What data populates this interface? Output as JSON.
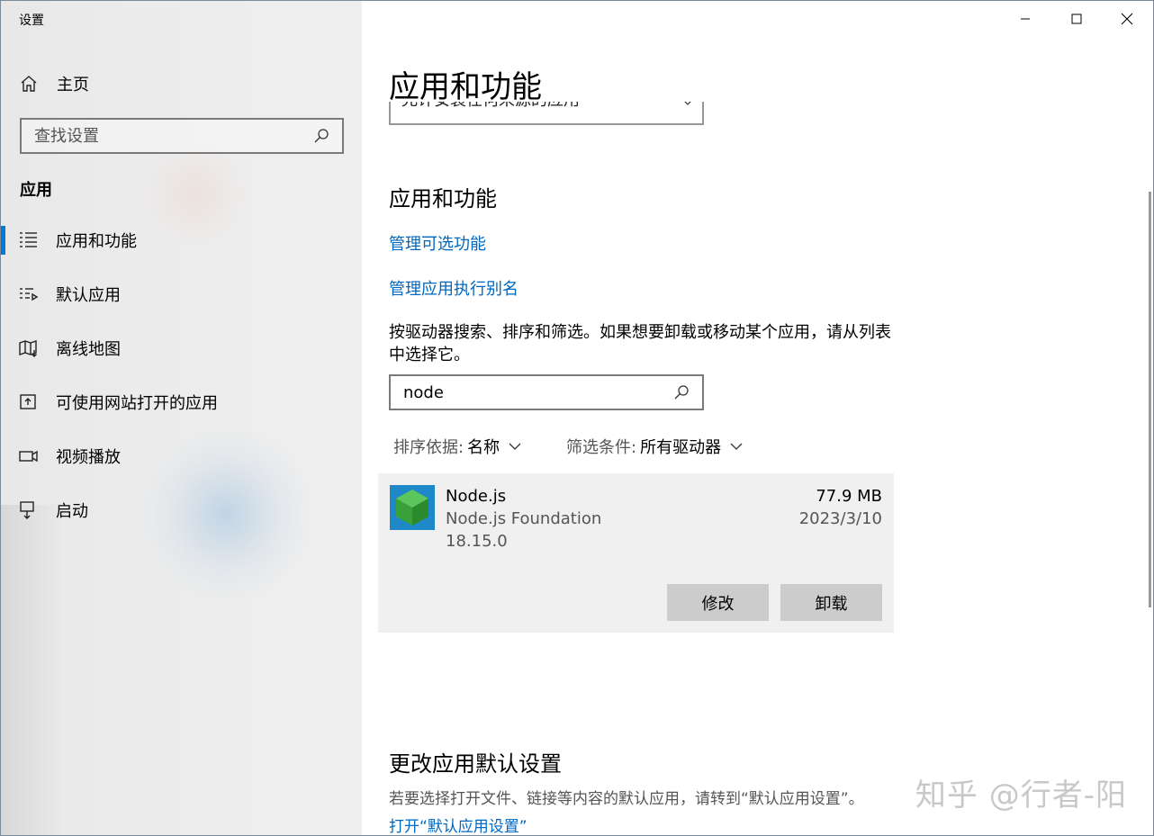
{
  "window": {
    "title": "设置"
  },
  "sidebar": {
    "home_label": "主页",
    "search_placeholder": "查找设置",
    "section_label": "应用",
    "items": [
      {
        "label": "应用和功能",
        "icon": "apps-features-icon",
        "active": true
      },
      {
        "label": "默认应用",
        "icon": "default-apps-icon",
        "active": false
      },
      {
        "label": "离线地图",
        "icon": "offline-maps-icon",
        "active": false
      },
      {
        "label": "可使用网站打开的应用",
        "icon": "apps-for-websites-icon",
        "active": false
      },
      {
        "label": "视频播放",
        "icon": "video-playback-icon",
        "active": false
      },
      {
        "label": "启动",
        "icon": "startup-icon",
        "active": false
      }
    ]
  },
  "main": {
    "page_title": "应用和功能",
    "partial_dropdown_text": "允许安装任何来源的应用",
    "section_title": "应用和功能",
    "link_optional_features": "管理可选功能",
    "link_app_alias": "管理应用执行别名",
    "description": "按驱动器搜索、排序和筛选。如果想要卸载或移动某个应用，请从列表中选择它。",
    "search_value": "node",
    "sort": {
      "label": "排序依据:",
      "value": "名称"
    },
    "filter": {
      "label": "筛选条件:",
      "value": "所有驱动器"
    },
    "app": {
      "name": "Node.js",
      "publisher": "Node.js Foundation",
      "version": "18.15.0",
      "size": "77.9 MB",
      "date": "2023/3/10",
      "modify_label": "修改",
      "uninstall_label": "卸载"
    },
    "default_section_title": "更改应用默认设置",
    "default_description": "若要选择打开文件、链接等内容的默认应用，请转到“默认应用设置”。",
    "default_link": "打开“默认应用设置”"
  },
  "watermark": "知乎 @行者-阳",
  "colors": {
    "accent": "#0078d4",
    "link": "#0067c0",
    "card_bg": "#f0f0f0",
    "button_bg": "#cccccc"
  }
}
